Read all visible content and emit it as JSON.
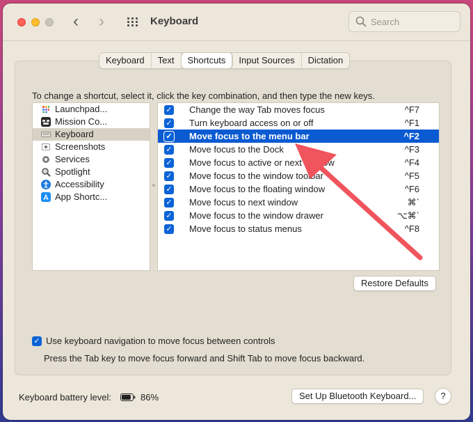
{
  "window": {
    "title": "Keyboard",
    "search_placeholder": "Search"
  },
  "tabs": [
    {
      "label": "Keyboard",
      "active": false
    },
    {
      "label": "Text",
      "active": false
    },
    {
      "label": "Shortcuts",
      "active": true
    },
    {
      "label": "Input Sources",
      "active": false
    },
    {
      "label": "Dictation",
      "active": false
    }
  ],
  "instructions": "To change a shortcut, select it, click the key combination, and then type the new keys.",
  "categories": [
    {
      "label": "Launchpad...",
      "icon": "launchpad-icon",
      "color": "#ffffff"
    },
    {
      "label": "Mission Co...",
      "icon": "mission-control-icon",
      "color": "#2b2b2b"
    },
    {
      "label": "Keyboard",
      "icon": "keyboard-icon",
      "color": "#bdbab2",
      "selected": true
    },
    {
      "label": "Screenshots",
      "icon": "screenshot-icon",
      "color": "#8e8e8e"
    },
    {
      "label": "Services",
      "icon": "gear-icon",
      "color": "#7d7d7d"
    },
    {
      "label": "Spotlight",
      "icon": "spotlight-icon",
      "color": "#6b6b6b"
    },
    {
      "label": "Accessibility",
      "icon": "accessibility-icon",
      "color": "#1f7ae0"
    },
    {
      "label": "App Shortc...",
      "icon": "app-store-icon",
      "color": "#1c8df5"
    }
  ],
  "shortcuts": [
    {
      "label": "Change the way Tab moves focus",
      "key": "^F7",
      "checked": true
    },
    {
      "label": "Turn keyboard access on or off",
      "key": "^F1",
      "checked": true
    },
    {
      "label": "Move focus to the menu bar",
      "key": "^F2",
      "checked": true,
      "selected": true
    },
    {
      "label": "Move focus to the Dock",
      "key": "^F3",
      "checked": true
    },
    {
      "label": "Move focus to active or next window",
      "key": "^F4",
      "checked": true
    },
    {
      "label": "Move focus to the window toolbar",
      "key": "^F5",
      "checked": true
    },
    {
      "label": "Move focus to the floating window",
      "key": "^F6",
      "checked": true
    },
    {
      "label": "Move focus to next window",
      "key": "⌘`",
      "checked": true
    },
    {
      "label": "Move focus to the window drawer",
      "key": "⌥⌘`",
      "checked": true
    },
    {
      "label": "Move focus to status menus",
      "key": "^F8",
      "checked": true
    }
  ],
  "buttons": {
    "restore_defaults": "Restore Defaults",
    "bluetooth_setup": "Set Up Bluetooth Keyboard...",
    "help": "?"
  },
  "keyboard_navigation": {
    "checked": true,
    "label": "Use keyboard navigation to move focus between controls",
    "help_text": "Press the Tab key to move focus forward and Shift Tab to move focus backward."
  },
  "battery": {
    "label": "Keyboard battery level:",
    "value": "86%",
    "level": 0.86
  },
  "colors": {
    "accent": "#0a5ad2",
    "annotation_arrow": "#f0545c"
  }
}
